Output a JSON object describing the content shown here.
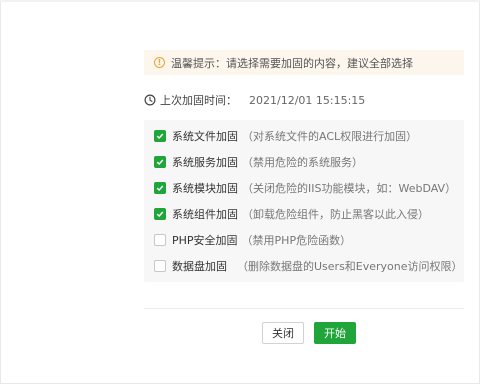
{
  "tip": {
    "icon": "warning-circle-icon",
    "text": "温馨提示：请选择需要加固的内容，建议全部选择"
  },
  "last_hardening": {
    "icon": "clock-icon",
    "label": "上次加固时间：",
    "time": "2021/12/01 15:15:15"
  },
  "items": [
    {
      "label": "系统文件加固",
      "desc": "（对系统文件的ACL权限进行加固）",
      "checked": true
    },
    {
      "label": "系统服务加固",
      "desc": "（禁用危险的系统服务）",
      "checked": true
    },
    {
      "label": "系统模块加固",
      "desc": "（关闭危险的IIS功能模块，如：WebDAV）",
      "checked": true
    },
    {
      "label": "系统组件加固",
      "desc": "（卸载危险组件，防止黑客以此入侵）",
      "checked": true
    },
    {
      "label": "PHP安全加固",
      "desc": "（禁用PHP危险函数）",
      "checked": false
    },
    {
      "label": "数据盘加固",
      "desc": "（删除数据盘的Users和Everyone访问权限）",
      "checked": false
    }
  ],
  "buttons": {
    "close": "关闭",
    "start": "开始"
  },
  "colors": {
    "accent": "#20a53a",
    "warning": "#e6a23c",
    "tip_bg": "#fdf6ec"
  }
}
